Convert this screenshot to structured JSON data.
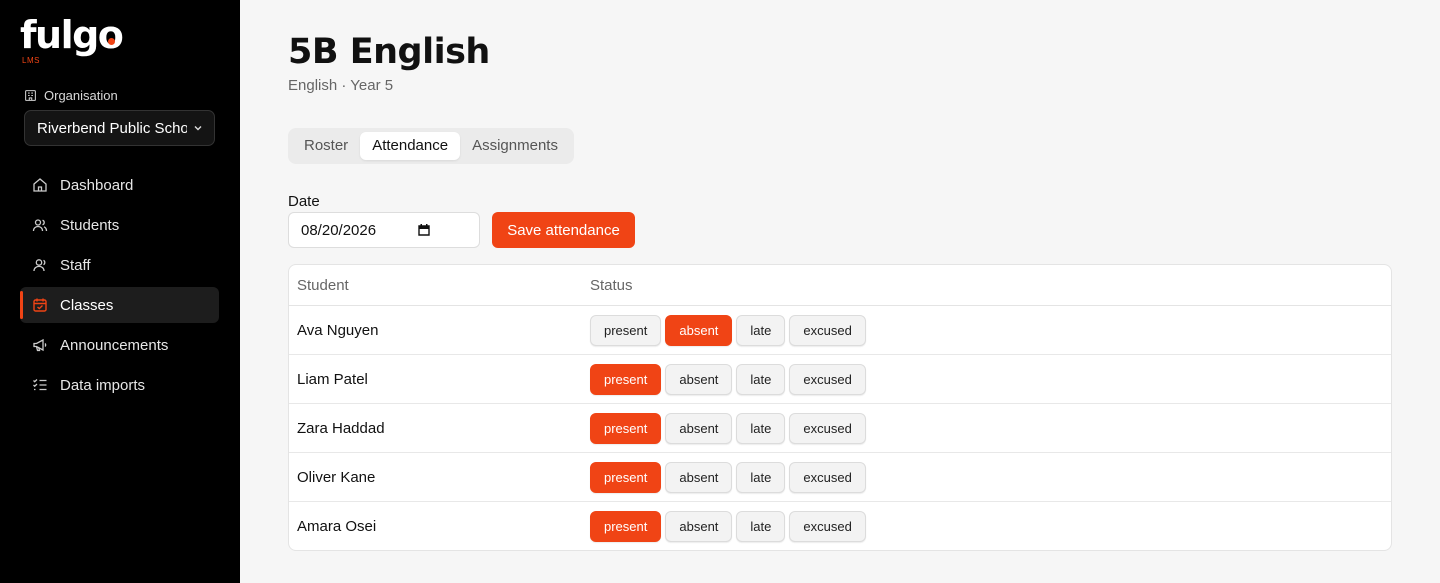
{
  "brand": {
    "name": "fulgo",
    "sub": "LMS",
    "accent": "#f04415"
  },
  "sidebar": {
    "org_label": "Organisation",
    "org_value": "Riverbend Public School",
    "items": [
      {
        "label": "Dashboard",
        "icon": "home-icon"
      },
      {
        "label": "Students",
        "icon": "users-icon"
      },
      {
        "label": "Staff",
        "icon": "user-icon"
      },
      {
        "label": "Classes",
        "icon": "calendar-icon",
        "active": true
      },
      {
        "label": "Announcements",
        "icon": "megaphone-icon"
      },
      {
        "label": "Data imports",
        "icon": "list-check-icon"
      }
    ]
  },
  "page": {
    "title": "5B English",
    "subtitle": "English · Year 5"
  },
  "tabs": [
    {
      "label": "Roster"
    },
    {
      "label": "Attendance",
      "active": true
    },
    {
      "label": "Assignments"
    }
  ],
  "attendance": {
    "date_label": "Date",
    "date_value": "08/20/2026",
    "save_label": "Save attendance",
    "columns": [
      "Student",
      "Status"
    ],
    "statuses": [
      "present",
      "absent",
      "late",
      "excused"
    ],
    "rows": [
      {
        "name": "Ava Nguyen",
        "selected": "absent"
      },
      {
        "name": "Liam Patel",
        "selected": "present"
      },
      {
        "name": "Zara Haddad",
        "selected": "present"
      },
      {
        "name": "Oliver Kane",
        "selected": "present"
      },
      {
        "name": "Amara Osei",
        "selected": "present"
      }
    ]
  }
}
